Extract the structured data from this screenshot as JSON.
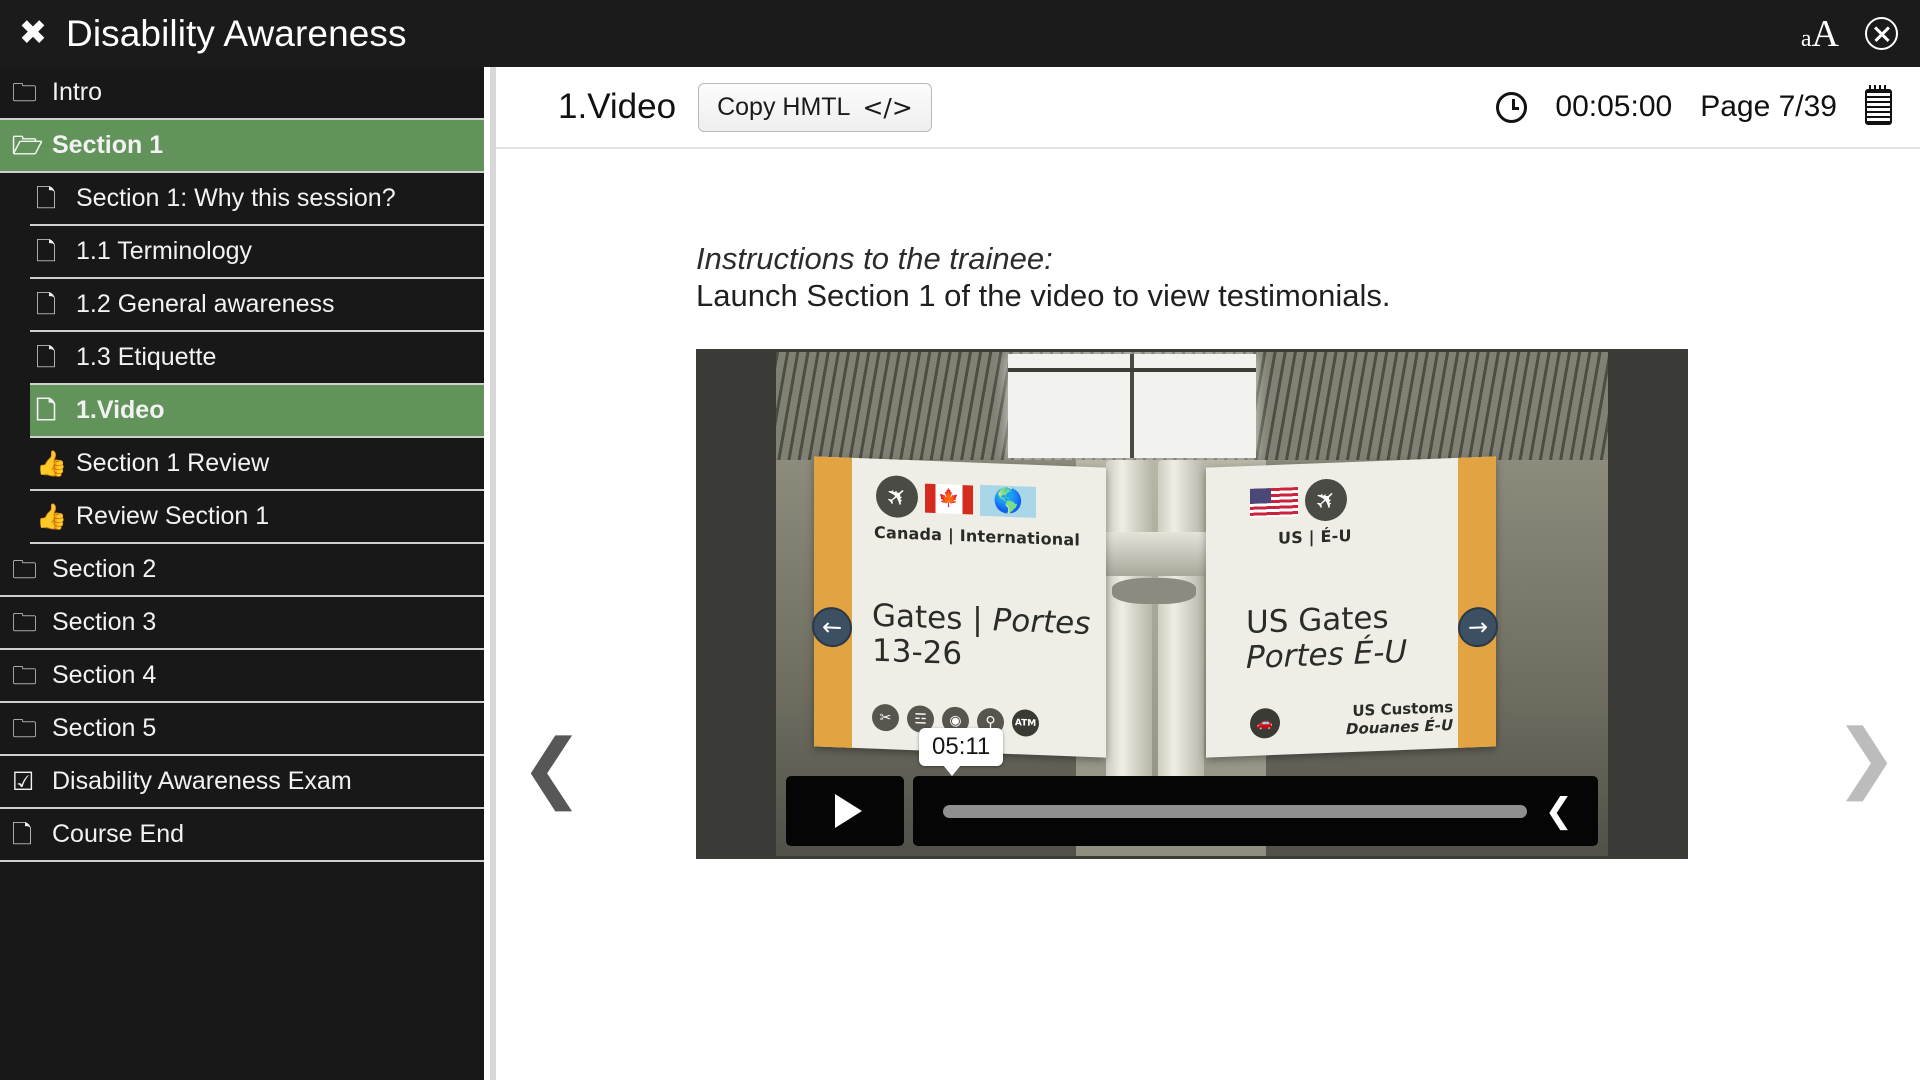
{
  "topbar": {
    "close_icon": "close-x-icon",
    "title": "Disability Awareness",
    "font_size_small": "a",
    "font_size_large": "A",
    "exit_icon": "close-circle-icon"
  },
  "sidebar": {
    "items": [
      {
        "label": "Intro",
        "icon": "folder-closed-icon",
        "level": 0,
        "selected": false
      },
      {
        "label": "Section 1",
        "icon": "folder-open-icon",
        "level": 0,
        "selected": true
      },
      {
        "label": "Section 1: Why this session?",
        "icon": "page-icon",
        "level": 1,
        "selected": false
      },
      {
        "label": "1.1 Terminology",
        "icon": "page-icon",
        "level": 1,
        "selected": false
      },
      {
        "label": "1.2 General awareness",
        "icon": "page-icon",
        "level": 1,
        "selected": false
      },
      {
        "label": "1.3 Etiquette",
        "icon": "page-icon",
        "level": 1,
        "selected": false
      },
      {
        "label": "1.Video",
        "icon": "page-icon",
        "level": 1,
        "selected": true
      },
      {
        "label": "Section 1 Review",
        "icon": "thumbs-up-icon",
        "level": 1,
        "selected": false
      },
      {
        "label": "Review Section 1",
        "icon": "thumbs-up-icon",
        "level": 1,
        "selected": false
      },
      {
        "label": "Section 2",
        "icon": "folder-closed-icon",
        "level": 0,
        "selected": false
      },
      {
        "label": "Section 3",
        "icon": "folder-closed-icon",
        "level": 0,
        "selected": false
      },
      {
        "label": "Section 4",
        "icon": "folder-closed-icon",
        "level": 0,
        "selected": false
      },
      {
        "label": "Section 5",
        "icon": "folder-closed-icon",
        "level": 0,
        "selected": false
      },
      {
        "label": "Disability Awareness Exam",
        "icon": "checkbox-checked-icon",
        "level": 0,
        "selected": false
      },
      {
        "label": "Course End",
        "icon": "page-icon",
        "level": 0,
        "selected": false
      }
    ]
  },
  "toolbar": {
    "page_title": "1.Video",
    "copy_html_label": "Copy HMTL",
    "copy_html_glyph": "</>",
    "clock_icon": "clock-icon",
    "timer": "00:05:00",
    "page_counter": "Page 7/39",
    "notes_icon": "notepad-icon"
  },
  "content": {
    "instructions_heading": "Instructions to the trainee:",
    "instructions_body": "Launch Section 1 of the video to view testimonials."
  },
  "video": {
    "play_icon": "play-icon",
    "time_tooltip": "05:11",
    "next_icon": "chevron-left-icon",
    "sign_left": {
      "caption": "Canada | International",
      "line1": "Gates | ",
      "line1_italic": "Portes",
      "line2": "13-26",
      "arrow": "←",
      "amenities": [
        "✂",
        "☲",
        "◉",
        "⚲",
        "ATM"
      ]
    },
    "sign_right": {
      "caption": "US | É-U",
      "line1": "US Gates",
      "line2": "Portes É-U",
      "arrow": "→",
      "customs_line1": "US Customs",
      "customs_line2": "Douanes É-U"
    }
  },
  "navigation": {
    "prev_icon": "❮",
    "next_icon": "❯"
  },
  "colors": {
    "accent_green": "#62935b",
    "topbar_bg": "#1b1b1b",
    "sidebar_bg": "#181818"
  }
}
